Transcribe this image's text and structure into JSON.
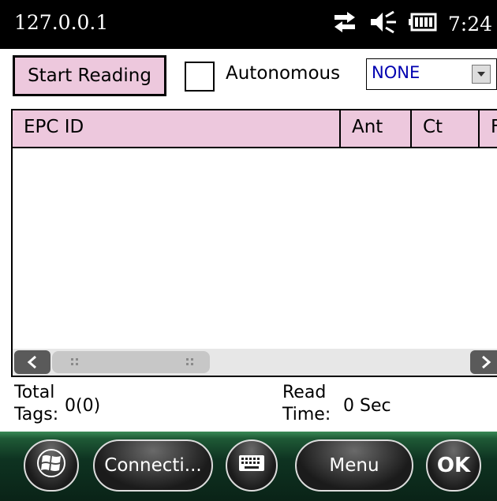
{
  "status_bar": {
    "title": "127.0.0.1",
    "time": "7:24",
    "icons": [
      "connectivity-icon",
      "volume-icon",
      "battery-icon"
    ]
  },
  "toolbar": {
    "start_button": "Start Reading",
    "autonomous_label": "Autonomous",
    "autonomous_checked": false,
    "mode_select": {
      "value": "NONE"
    }
  },
  "table": {
    "columns": [
      "EPC ID",
      "Ant",
      "Ct",
      "F"
    ],
    "rows": []
  },
  "footer": {
    "total_tags_label_line1": "Total",
    "total_tags_label_line2": "Tags:",
    "total_tags_value": "0(0)",
    "read_time_label_line1": "Read",
    "read_time_label_line2": "Time:",
    "read_time_value": "0 Sec"
  },
  "taskbar": {
    "connection_button": "Connecti...",
    "menu_button": "Menu",
    "ok_button": "OK"
  },
  "colors": {
    "header_bg": "#edc8dd",
    "status_bar": "#000000",
    "select_text": "#0000b0"
  }
}
